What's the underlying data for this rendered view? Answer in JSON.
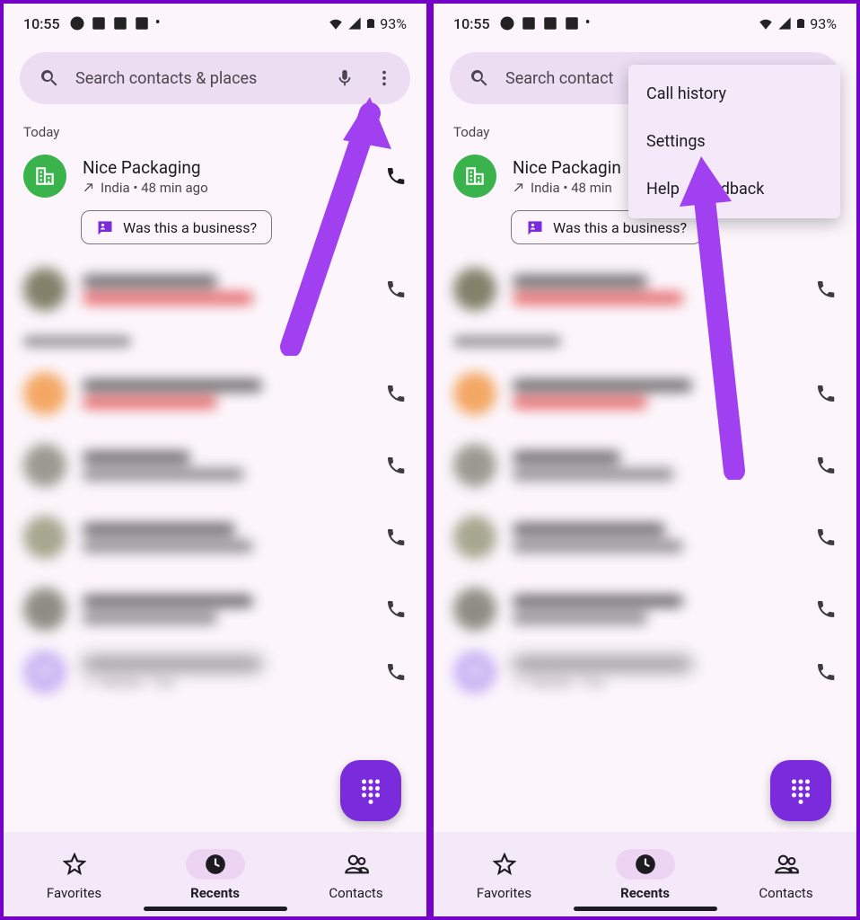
{
  "status": {
    "time": "10:55",
    "battery": "93%"
  },
  "search": {
    "placeholder": "Search contacts & places"
  },
  "section_today": "Today",
  "call": {
    "name": "Nice Packaging",
    "sub": "India • 48 min ago"
  },
  "biz_chip": "Was this a business?",
  "menu": {
    "history": "Call history",
    "settings": "Settings",
    "help": "Help & Feedback"
  },
  "nav": {
    "favorites": "Favorites",
    "recents": "Recents",
    "contacts": "Contacts"
  },
  "blurred_last_sub": "Mobile • Tue"
}
